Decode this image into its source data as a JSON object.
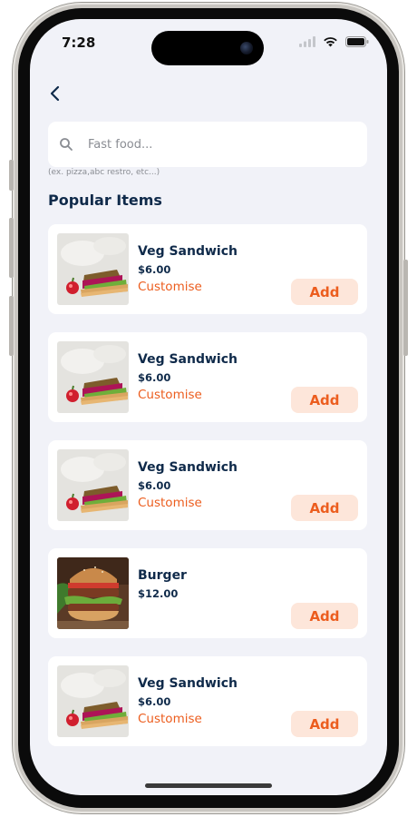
{
  "status_bar": {
    "time": "7:28",
    "icons": [
      "signal-icon",
      "wifi-icon",
      "battery-icon"
    ]
  },
  "header": {
    "back_icon": "chevron-left-icon"
  },
  "search": {
    "placeholder": "Fast food...",
    "value": "",
    "hint": "(ex. pizza,abc restro, etc...)",
    "icon": "search-icon"
  },
  "section": {
    "title": "Popular Items"
  },
  "items": [
    {
      "name": "Veg Sandwich",
      "price": "$6.00",
      "customise": "Customise",
      "add": "Add",
      "image": "sandwich"
    },
    {
      "name": "Veg Sandwich",
      "price": "$6.00",
      "customise": "Customise",
      "add": "Add",
      "image": "sandwich"
    },
    {
      "name": "Veg Sandwich",
      "price": "$6.00",
      "customise": "Customise",
      "add": "Add",
      "image": "sandwich"
    },
    {
      "name": "Burger",
      "price": "$12.00",
      "customise": "",
      "add": "Add",
      "image": "burger"
    },
    {
      "name": "Veg Sandwich",
      "price": "$6.00",
      "customise": "Customise",
      "add": "Add",
      "image": "sandwich"
    }
  ],
  "colors": {
    "accent": "#ec5d1e",
    "accent_bg": "#fde6da",
    "text_primary": "#0f2a4a",
    "screen_bg": "#f1f2f8"
  }
}
